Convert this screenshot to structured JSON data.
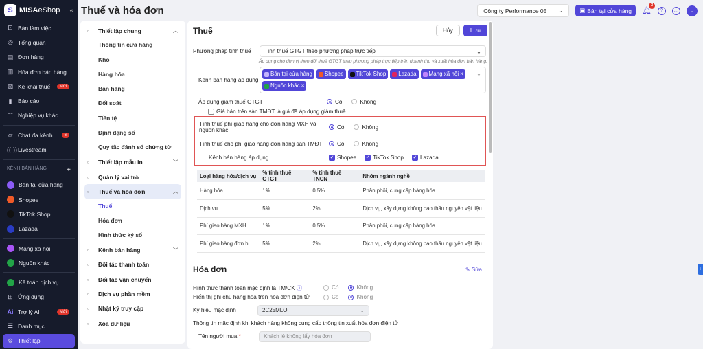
{
  "app": {
    "brand_bold": "MISA",
    "brand": "eShop",
    "collapse": "«"
  },
  "sidebar": {
    "items": [
      {
        "label": "Bàn làm việc",
        "icon": "desk-icon"
      },
      {
        "label": "Tổng quan",
        "icon": "dashboard-icon"
      },
      {
        "label": "Đơn hàng",
        "icon": "order-icon"
      },
      {
        "label": "Hóa đơn bán hàng",
        "icon": "invoice-icon"
      },
      {
        "label": "Kê khai thuế",
        "icon": "tax-icon",
        "badge": "Mới"
      },
      {
        "label": "Báo cáo",
        "icon": "report-icon"
      },
      {
        "label": "Nghiệp vụ khác",
        "icon": "tasks-icon"
      }
    ],
    "items2": [
      {
        "label": "Chat đa kênh",
        "badge": "6"
      },
      {
        "label": "Livestream"
      }
    ],
    "section": "KÊNH BÁN HÀNG",
    "section_add": "+",
    "channels": [
      {
        "label": "Bán tại cửa hàng",
        "color": "#8b5cf6"
      },
      {
        "label": "Shopee",
        "color": "#f05a28"
      },
      {
        "label": "TikTok Shop",
        "color": "#111111"
      },
      {
        "label": "Lazada",
        "color": "#2a3cc4"
      }
    ],
    "channels2": [
      {
        "label": "Mạng xã hội",
        "color": "#a855f7"
      },
      {
        "label": "Nguồn khác",
        "color": "#22a447"
      }
    ],
    "bottom": [
      {
        "label": "Kế toán dịch vụ"
      },
      {
        "label": "Ứng dụng"
      },
      {
        "label": "Trợ lý AI",
        "badge": "Mới"
      },
      {
        "label": "Danh mục"
      },
      {
        "label": "Thiết lập"
      }
    ]
  },
  "header": {
    "title": "Thuế và hóa đơn",
    "company": "Công ty Performance 05",
    "store_button": "Bán tại cửa hàng",
    "notif_count": "3"
  },
  "menu": {
    "general": "Thiết lập chung",
    "general_items": [
      "Thông tin cửa hàng",
      "Kho",
      "Hàng hóa",
      "Bán hàng",
      "Đối soát",
      "Tiền tệ",
      "Định dạng số",
      "Quy tắc đánh số chứng từ"
    ],
    "print": "Thiết lập mẫu in",
    "roles": "Quản lý vai trò",
    "tax": "Thuế và hóa đơn",
    "tax_items": [
      "Thuế",
      "Hóa đơn",
      "Hình thức ký số"
    ],
    "others": [
      "Kênh bán hàng",
      "Đối tác thanh toán",
      "Đối tác vận chuyển",
      "Dịch vụ phần mềm",
      "Nhật ký truy cập",
      "Xóa dữ liệu"
    ]
  },
  "tax": {
    "title": "Thuế",
    "cancel": "Hủy",
    "save": "Lưu",
    "method_label": "Phương pháp tính thuế",
    "method_value": "Tính thuế GTGT theo phương pháp trực tiếp",
    "method_hint": "Áp dụng cho đơn vị theo dõi thuế GTGT theo phương pháp trực tiếp trên doanh thu và xuất hóa đơn bán hàng.",
    "channels_label": "Kênh bán hàng áp dụng",
    "tags": [
      {
        "label": "Bán tại cửa hàng",
        "color": "#c4b5fd"
      },
      {
        "label": "Shopee",
        "color": "#f05a28"
      },
      {
        "label": "TikTok Shop",
        "color": "#111111"
      },
      {
        "label": "Lazada",
        "color": "#e0245e"
      },
      {
        "label": "Mạng xã hội",
        "color": "#c084fc",
        "x": "×"
      },
      {
        "label": "Nguồn khác",
        "color": "#22a447",
        "x": "×"
      }
    ],
    "reduce_label": "Áp dụng giảm thuế GTGT",
    "yes": "Có",
    "no": "Không",
    "reduce_check": "Giá bán trên sàn TMĐT là giá đã áp dụng giảm thuế",
    "ship_social": "Tính thuế phí giao hàng cho đơn hàng MXH và nguồn khác",
    "ship_ecom": "Tính thuế cho phí giao hàng đơn hàng sàn TMĐT",
    "ship_channels_label": "Kênh bán hàng áp dụng",
    "ship_channels": [
      "Shopee",
      "TikTok Shop",
      "Lazada"
    ],
    "table": {
      "headers": [
        "Loại hàng hóa/dịch vụ",
        "% tính thuế GTGT",
        "% tính thuế TNCN",
        "Nhóm ngành nghề"
      ],
      "rows": [
        [
          "Hàng hóa",
          "1%",
          "0.5%",
          "Phân phối, cung cấp hàng hóa"
        ],
        [
          "Dịch vụ",
          "5%",
          "2%",
          "Dịch vụ, xây dựng không bao thầu nguyên vật liệu"
        ],
        [
          "Phí giao hàng MXH ...",
          "1%",
          "0.5%",
          "Phân phối, cung cấp hàng hóa"
        ],
        [
          "Phí giao hàng đơn h...",
          "5%",
          "2%",
          "Dịch vụ, xây dựng không bao thầu nguyên vật liệu"
        ]
      ]
    }
  },
  "invoice": {
    "title": "Hóa đơn",
    "edit": "Sửa",
    "payment_label": "Hình thức thanh toán mặc định là TM/CK",
    "note_label": "Hiển thị ghi chú hàng hóa trên hóa đơn điện tử",
    "symbol_label": "Ký hiệu mặc định",
    "symbol_value": "2C25MLO",
    "default_info": "Thông tin mặc định khi khách hàng không cung cấp thông tin xuất hóa đơn điện tử",
    "buyer_label": "Tên người mua",
    "required": "*",
    "buyer_value": "Khách lẻ không lấy hóa đơn"
  }
}
